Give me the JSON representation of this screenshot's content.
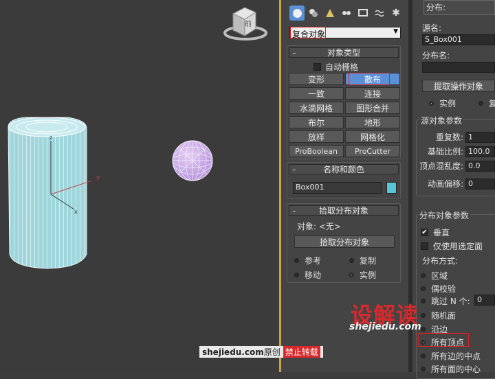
{
  "viewport": {
    "viewcube_label": "前"
  },
  "command_panel": {
    "tabs": [
      "create-icon",
      "modify-icon",
      "hierarchy-icon",
      "motion-icon",
      "display-icon",
      "utilities-icon",
      "extra-icon"
    ],
    "category": "复合对象",
    "object_type": {
      "title": "对象类型",
      "autogrid": "自动栅格",
      "buttons": [
        "变形",
        "散布",
        "一致",
        "连接",
        "水滴网格",
        "图形合并",
        "布尔",
        "地形",
        "放样",
        "网格化",
        "ProBoolean",
        "ProCutter"
      ]
    },
    "name_color": {
      "title": "名称和颜色",
      "name": "Box001",
      "color": "#58c5d8"
    },
    "pick_distribution": {
      "title": "拾取分布对象",
      "object_label": "对象: <无>",
      "pick_button": "拾取分布对象",
      "options": [
        "参考",
        "复制",
        "移动",
        "实例"
      ]
    }
  },
  "right_panel": {
    "top_label": "分布:",
    "source_name_label": "源名:",
    "source_name": "S_Box001",
    "dist_name_label": "分布名:",
    "dist_name": "",
    "extract_button": "提取操作对象",
    "instance_label": "实例",
    "copy_label": "复",
    "source_params": {
      "title": "源对象参数",
      "duplicates_label": "重复数:",
      "duplicates": "1",
      "base_scale_label": "基础比例:",
      "base_scale": "100.0",
      "vertex_chaos_label": "顶点混乱度:",
      "vertex_chaos": "0.0",
      "anim_offset_label": "动画偏移:",
      "anim_offset": "0"
    },
    "distribution_params": {
      "title": "分布对象参数",
      "perpendicular": "垂直",
      "use_selected_faces": "仅使用选定面",
      "method_label": "分布方式:",
      "methods": [
        "区域",
        "偶校验",
        "跳过 N 个:",
        "随机面",
        "沿边",
        "所有顶点",
        "所有边的中点",
        "所有面的中心"
      ],
      "skip_n": "0"
    }
  },
  "watermarks": {
    "brand_cn": "设解读",
    "brand_url": "shejiedu.com",
    "credit_site": "shejiedu.com",
    "credit_original": "原创",
    "credit_warning": "禁止转载"
  }
}
